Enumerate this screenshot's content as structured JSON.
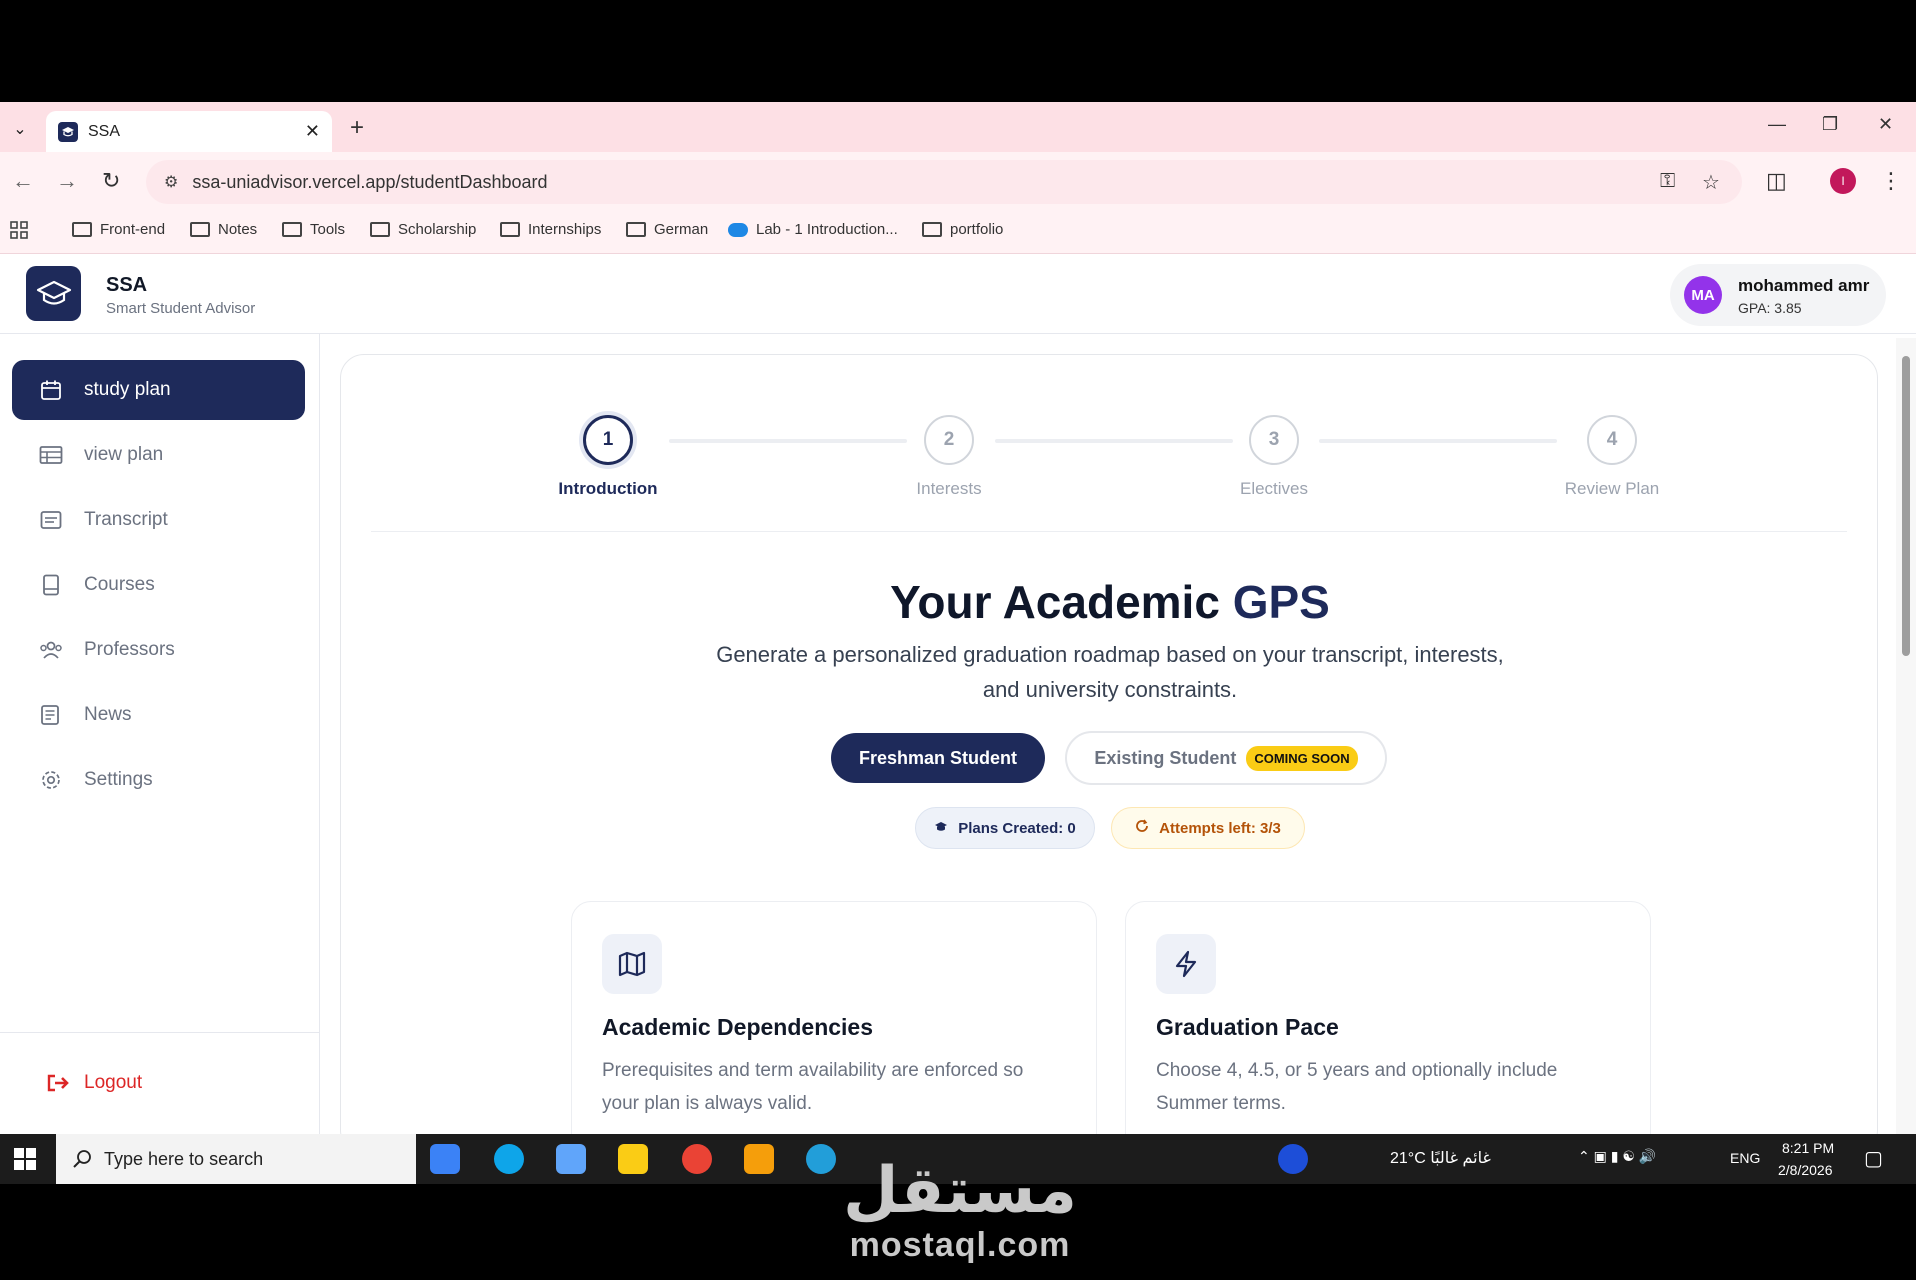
{
  "browser": {
    "tab_title": "SSA",
    "url": "ssa-uniadvisor.vercel.app/studentDashboard",
    "profile_initial": "I",
    "bookmarks": [
      "Front-end",
      "Notes",
      "Tools",
      "Scholarship",
      "Internships",
      "German",
      "Lab - 1 Introduction...",
      "portfolio"
    ]
  },
  "header": {
    "brand_title": "SSA",
    "brand_subtitle": "Smart Student Advisor",
    "user": {
      "initials": "MA",
      "name": "mohammed amr",
      "gpa": "GPA: 3.85"
    }
  },
  "sidebar": {
    "items": [
      {
        "label": "study plan",
        "icon": "calendar-icon",
        "active": true
      },
      {
        "label": "view plan",
        "icon": "table-icon",
        "active": false
      },
      {
        "label": "Transcript",
        "icon": "transcript-icon",
        "active": false
      },
      {
        "label": "Courses",
        "icon": "book-icon",
        "active": false
      },
      {
        "label": "Professors",
        "icon": "users-icon",
        "active": false
      },
      {
        "label": "News",
        "icon": "newspaper-icon",
        "active": false
      },
      {
        "label": "Settings",
        "icon": "gear-icon",
        "active": false
      }
    ],
    "logout_label": "Logout"
  },
  "stepper": {
    "steps": [
      {
        "number": "1",
        "label": "Introduction",
        "active": true
      },
      {
        "number": "2",
        "label": "Interests",
        "active": false
      },
      {
        "number": "3",
        "label": "Electives",
        "active": false
      },
      {
        "number": "4",
        "label": "Review Plan",
        "active": false
      }
    ]
  },
  "hero": {
    "title_main": "Your Academic ",
    "title_accent": "GPS",
    "subtitle": "Generate a personalized graduation roadmap based on your transcript, interests, and university constraints."
  },
  "actions": {
    "freshman_label": "Freshman Student",
    "existing_label": "Existing Student",
    "coming_soon": "COMING SOON"
  },
  "stats": {
    "plans_created": "Plans Created: 0",
    "attempts_left": "Attempts left: 3/3"
  },
  "cards": [
    {
      "title": "Academic Dependencies",
      "body": "Prerequisites and term availability are enforced so your plan is always valid.",
      "icon": "map-icon"
    },
    {
      "title": "Graduation Pace",
      "body": "Choose 4, 4.5, or 5 years and optionally include Summer terms.",
      "icon": "lightning-icon"
    }
  ],
  "taskbar": {
    "search_placeholder": "Type here to search",
    "weather": "21°C  غائم غالبًا",
    "language": "ENG",
    "time": "8:21 PM",
    "date": "2/8/2026"
  },
  "watermark": {
    "arabic": "مستقل",
    "latin": "mostaql.com"
  },
  "colors": {
    "primary": "#1e2a5a",
    "accent_yellow": "#facc15",
    "danger": "#dc2626",
    "avatar": "#9333ea"
  }
}
